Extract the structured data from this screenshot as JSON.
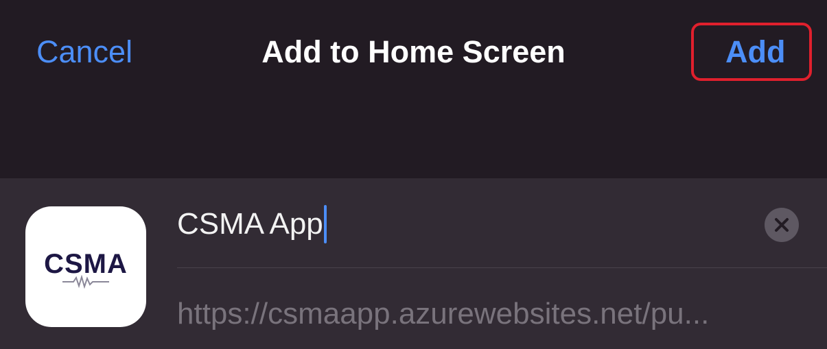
{
  "header": {
    "cancel_label": "Cancel",
    "title": "Add to Home Screen",
    "add_label": "Add"
  },
  "app": {
    "icon_text": "CSMA",
    "name": "CSMA App",
    "url": "https://csmaapp.azurewebsites.net/pu..."
  },
  "colors": {
    "background": "#221b23",
    "card": "#322b34",
    "accent": "#4c8ef7",
    "highlight": "#e0202d"
  },
  "icons": {
    "clear": "x-circle-icon",
    "app": "csma-app-icon"
  }
}
